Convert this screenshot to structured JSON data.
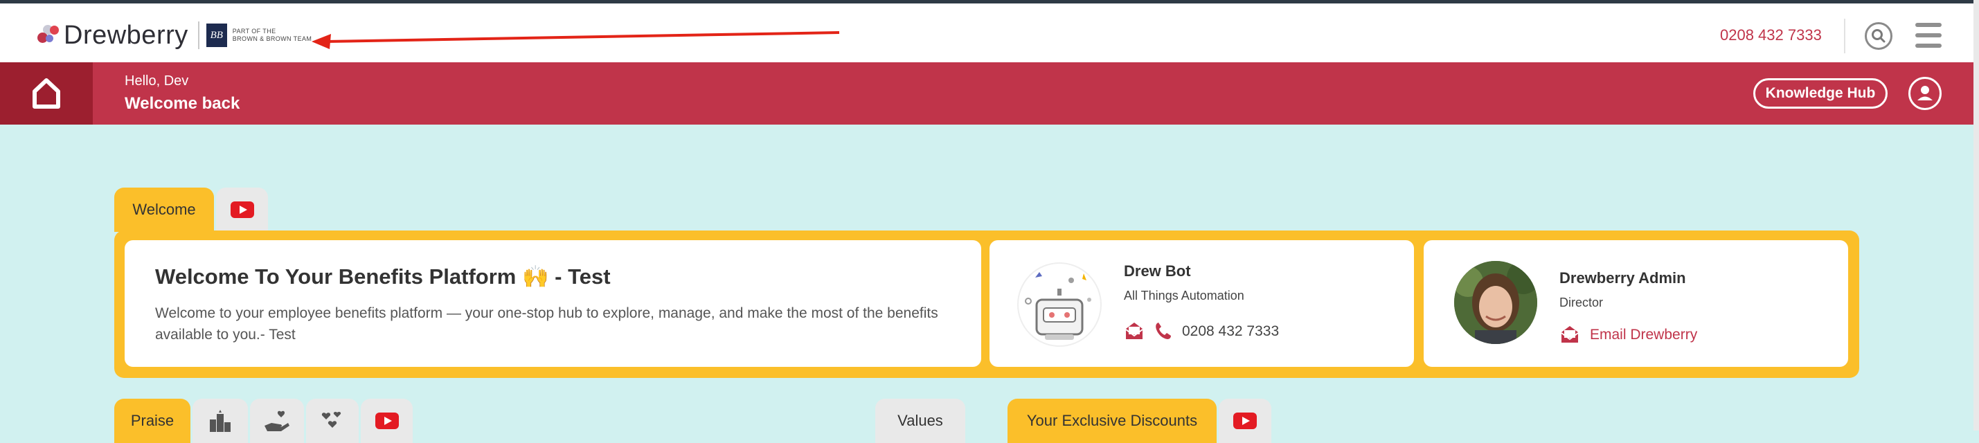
{
  "header": {
    "brand": "Drewberry",
    "partner_lines": [
      "PART OF THE",
      "BROWN & BROWN TEAM"
    ],
    "partner_monogram": "BB",
    "phone": "0208 432 7333",
    "icons": [
      "search-icon",
      "menu-icon"
    ]
  },
  "banner": {
    "greeting": "Hello, Dev",
    "subtitle": "Welcome back",
    "knowledge_hub_label": "Knowledge Hub",
    "icons": [
      "home-icon",
      "user-icon"
    ]
  },
  "welcome_section": {
    "tabs": [
      {
        "label": "Welcome",
        "active": true
      },
      {
        "label": "",
        "icon": "youtube-icon",
        "active": false
      }
    ],
    "title": "Welcome To Your Benefits Platform 🙌 - Test",
    "body": "Welcome to your employee benefits platform — your one-stop hub to explore, manage, and make the most of the benefits available to you.- Test",
    "contacts": [
      {
        "name": "Drew Bot",
        "role": "All Things Automation",
        "phone": "0208 432 7333",
        "icons": [
          "robot-icon",
          "email-icon",
          "phone-icon"
        ]
      },
      {
        "name": "Drewberry Admin",
        "role": "Director",
        "email_label": "Email Drewberry",
        "icons": [
          "avatar-photo",
          "email-icon"
        ]
      }
    ]
  },
  "lower_tabs": {
    "praise": [
      {
        "label": "Praise",
        "active": true
      },
      {
        "label": "",
        "icon": "leaderboard-icon"
      },
      {
        "label": "",
        "icon": "hand-heart-icon"
      },
      {
        "label": "",
        "icon": "hearts-icon"
      },
      {
        "label": "",
        "icon": "youtube-icon"
      }
    ],
    "values": {
      "label": "Values"
    },
    "discounts": [
      {
        "label": "Your Exclusive Discounts",
        "active": true
      },
      {
        "label": "",
        "icon": "youtube-icon"
      }
    ]
  },
  "colors": {
    "brand_red": "#c0344a",
    "dark_red": "#9c1f2f",
    "accent_yellow": "#fbbf2a",
    "background": "#d1f1f0"
  }
}
